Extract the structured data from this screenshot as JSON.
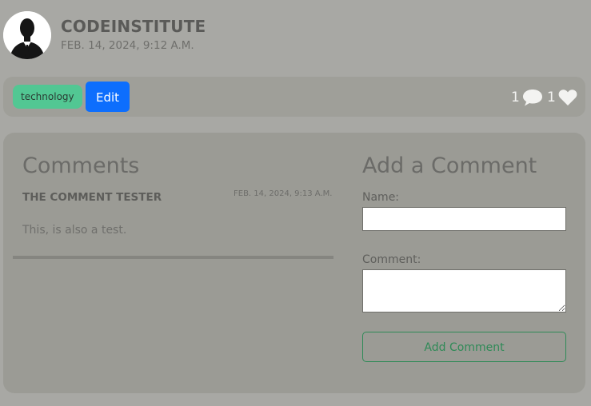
{
  "post": {
    "author": "CODEINSTITUTE",
    "date": "FEB. 14, 2024, 9:12 A.M.",
    "tag": "technology",
    "edit_label": "Edit",
    "comment_count": "1",
    "like_count": "1"
  },
  "comments_section": {
    "title": "Comments",
    "items": [
      {
        "author": "THE COMMENT TESTER",
        "date": "FEB. 14, 2024, 9:13 A.M.",
        "body": "This, is also a test."
      }
    ]
  },
  "add_comment": {
    "title": "Add a Comment",
    "name_label": "Name:",
    "name_value": "",
    "comment_label": "Comment:",
    "comment_value": "",
    "submit_label": "Add Comment"
  },
  "colors": {
    "page_background": "#a8a8a4",
    "tag_background": "#52c793",
    "edit_button": "#0d6efd",
    "submit_border": "#2f8a57"
  },
  "icons": {
    "avatar": "user-silhouette-icon",
    "comments": "speech-bubble-icon",
    "likes": "heart-icon"
  }
}
